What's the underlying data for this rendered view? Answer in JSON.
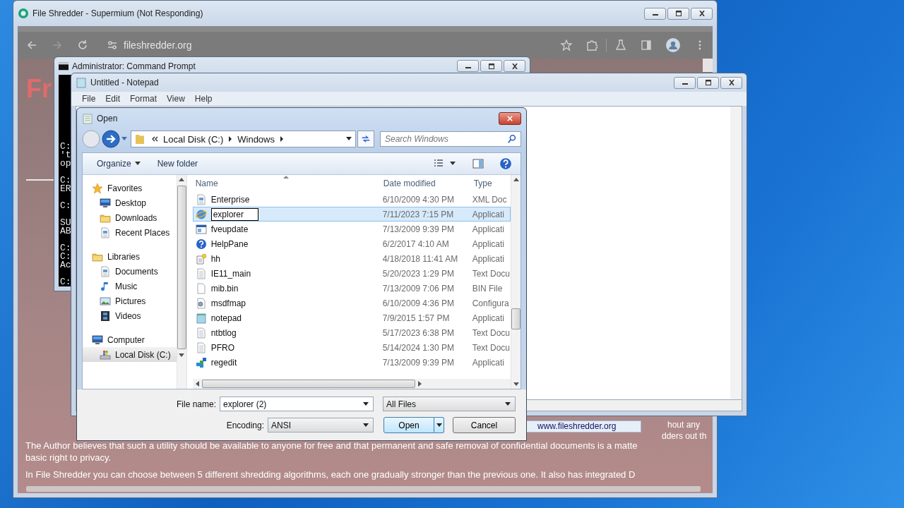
{
  "browser": {
    "title": "File Shredder - Supermium (Not Responding)",
    "url": "fileshredder.org",
    "page": {
      "heading": "Fr",
      "side_lines": [
        "hout any",
        "dders out th"
      ],
      "paragraphs": [
        "The Author believes that such a utility should be available to anyone for free and that permanent and safe removal of confidential documents is a matte",
        "basic right to privacy.",
        "In File Shredder you can choose between 5 different shredding algorithms, each one gradually stronger than the previous one. It also has integrated D"
      ]
    },
    "status_link": "www.fileshredder.org"
  },
  "console": {
    "title": "Administrator:  Command Prompt",
    "blocks": [
      [
        "C:",
        "'t",
        "op"
      ],
      [
        "C:",
        "ER"
      ],
      [
        "C:"
      ],
      [
        "SU",
        "AB"
      ],
      [
        "C:",
        "C:",
        "Ac"
      ],
      [
        "C:"
      ]
    ]
  },
  "notepad": {
    "title": "Untitled - Notepad",
    "menu": [
      "File",
      "Edit",
      "Format",
      "View",
      "Help"
    ]
  },
  "dialog": {
    "title": "Open",
    "path": [
      "Local Disk (C:)",
      "Windows"
    ],
    "search": {
      "placeholder": "Search Windows"
    },
    "toolbar": [
      "Organize",
      "New folder"
    ],
    "nav": [
      {
        "label": "Favorites",
        "kind": "star",
        "selected": false,
        "children": [
          {
            "label": "Desktop",
            "kind": "monitor",
            "selected": false
          },
          {
            "label": "Downloads",
            "kind": "folder",
            "selected": false
          },
          {
            "label": "Recent Places",
            "kind": "document",
            "selected": false
          }
        ]
      },
      {
        "label": "Libraries",
        "kind": "folder",
        "selected": false,
        "children": [
          {
            "label": "Documents",
            "kind": "document",
            "selected": false
          },
          {
            "label": "Music",
            "kind": "music",
            "selected": false
          },
          {
            "label": "Pictures",
            "kind": "picture",
            "selected": false
          },
          {
            "label": "Videos",
            "kind": "film",
            "selected": false
          }
        ]
      },
      {
        "label": "Computer",
        "kind": "monitor",
        "selected": false,
        "children": [
          {
            "label": "Local Disk (C:)",
            "kind": "drive",
            "selected": true
          }
        ]
      }
    ],
    "columns": [
      "Name",
      "Date modified",
      "Type"
    ],
    "files": [
      {
        "name": "Enterprise",
        "date": "6/10/2009 4:30 PM",
        "type": "XML Doc",
        "kind": "document",
        "selected": false,
        "renaming": false
      },
      {
        "name": "explorer",
        "date": "7/11/2023 7:15 PM",
        "type": "Applicati",
        "kind": "globe",
        "selected": true,
        "renaming": true
      },
      {
        "name": "fveupdate",
        "date": "7/13/2009 9:39 PM",
        "type": "Applicati",
        "kind": "window",
        "selected": false,
        "renaming": false
      },
      {
        "name": "HelpPane",
        "date": "6/2/2017 4:10 AM",
        "type": "Applicati",
        "kind": "help",
        "selected": false,
        "renaming": false
      },
      {
        "name": "hh",
        "date": "4/18/2018 11:41 AM",
        "type": "Applicati",
        "kind": "script",
        "selected": false,
        "renaming": false
      },
      {
        "name": "IE11_main",
        "date": "5/20/2023 1:29 PM",
        "type": "Text Docu",
        "kind": "text",
        "selected": false,
        "renaming": false
      },
      {
        "name": "mib.bin",
        "date": "7/13/2009 7:06 PM",
        "type": "BIN File",
        "kind": "blank",
        "selected": false,
        "renaming": false
      },
      {
        "name": "msdfmap",
        "date": "6/10/2009 4:36 PM",
        "type": "Configura",
        "kind": "gear",
        "selected": false,
        "renaming": false
      },
      {
        "name": "notepad",
        "date": "7/9/2015 1:57 PM",
        "type": "Applicati",
        "kind": "notepad",
        "selected": false,
        "renaming": false
      },
      {
        "name": "ntbtlog",
        "date": "5/17/2023 6:38 PM",
        "type": "Text Docu",
        "kind": "text",
        "selected": false,
        "renaming": false
      },
      {
        "name": "PFRO",
        "date": "5/14/2024 1:30 PM",
        "type": "Text Docu",
        "kind": "text",
        "selected": false,
        "renaming": false
      },
      {
        "name": "regedit",
        "date": "7/13/2009 9:39 PM",
        "type": "Applicati",
        "kind": "registry",
        "selected": false,
        "renaming": false
      }
    ],
    "file_name_label": "File name:",
    "file_name": "explorer (2)",
    "filter": "All Files",
    "encoding_label": "Encoding:",
    "encoding": "ANSI",
    "buttons": [
      "Open",
      "Cancel"
    ]
  }
}
